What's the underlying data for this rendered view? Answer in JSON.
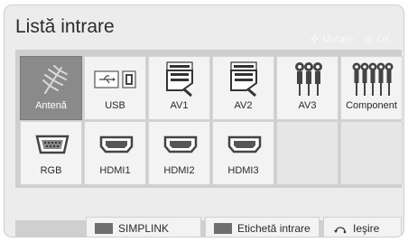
{
  "title": "Listă intrare",
  "hints": {
    "move_label": "Mutare",
    "ok_label": "OK"
  },
  "inputs": [
    {
      "label": "Antenă",
      "icon": "antenna-icon"
    },
    {
      "label": "USB",
      "icon": "usb-icon"
    },
    {
      "label": "AV1",
      "icon": "scart-icon"
    },
    {
      "label": "AV2",
      "icon": "scart-icon"
    },
    {
      "label": "AV3",
      "icon": "rca-icon"
    },
    {
      "label": "Component",
      "icon": "component-icon"
    },
    {
      "label": "RGB",
      "icon": "vga-icon"
    },
    {
      "label": "HDMI1",
      "icon": "hdmi-icon"
    },
    {
      "label": "HDMI2",
      "icon": "hdmi-icon"
    },
    {
      "label": "HDMI3",
      "icon": "hdmi-icon"
    }
  ],
  "footer": {
    "simplink_label": "SIMPLINK",
    "label_button_label": "Etichetă intrare",
    "exit_label": "Ieşire"
  },
  "colors": {
    "selected_tile": "#8a8a8a",
    "tile": "#f3f3f3",
    "panel": "#ececec"
  }
}
